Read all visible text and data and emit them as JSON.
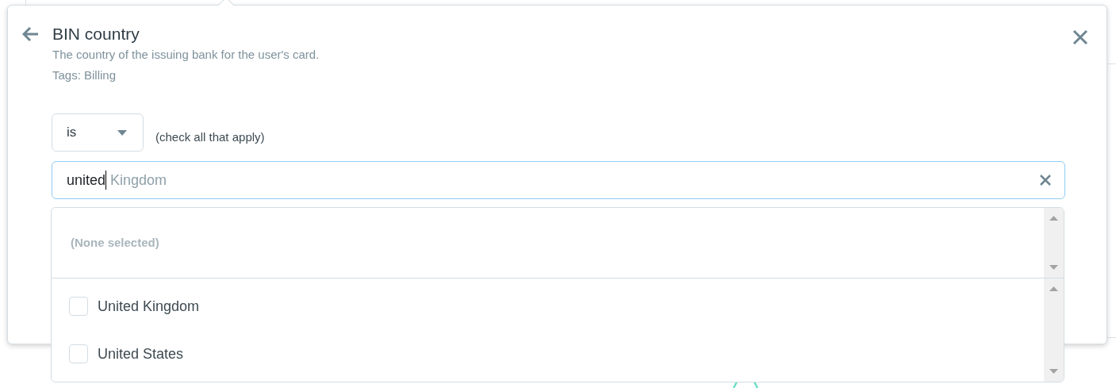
{
  "popover": {
    "title": "BIN country",
    "description": "The country of the issuing bank for the user's card.",
    "tags": "Tags: Billing"
  },
  "operator": {
    "value": "is",
    "hint": "(check all that apply)"
  },
  "search": {
    "value": "united",
    "completion": "Kingdom"
  },
  "selected_panel": {
    "empty_text": "(None selected)"
  },
  "options": [
    {
      "label": "United Kingdom",
      "checked": false
    },
    {
      "label": "United States",
      "checked": false
    }
  ]
}
